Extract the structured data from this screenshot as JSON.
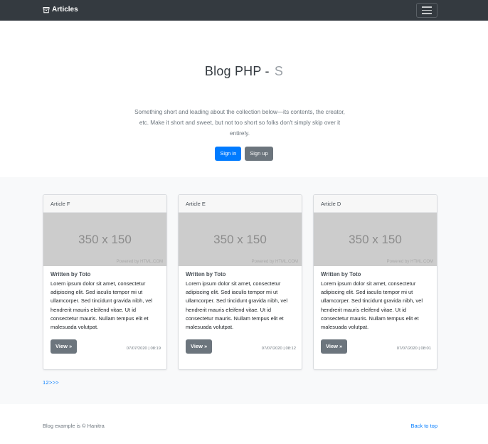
{
  "navbar": {
    "brand": "Articles",
    "brand_icon": "box-icon",
    "toggler_icon": "hamburger-menu-icon"
  },
  "hero": {
    "title": "Blog PHP",
    "title_separator": "-",
    "title_typed": "S",
    "lead": "Something short and leading about the collection below—its contents, the creator, etc. Make it short and sweet, but not too short so folks don't simply skip over it entirely.",
    "sign_in_label": "Sign in",
    "sign_up_label": "Sign up"
  },
  "cards": [
    {
      "header": "Article F",
      "image_text": "350 x 150",
      "image_caption": "Powered by HTML.COM",
      "author": "Written by Toto",
      "text": "Lorem ipsum dolor sit amet, consectetur adipiscing elit. Sed iaculis tempor mi ut ullamcorper. Sed tincidunt gravida nibh, vel hendrerit mauris eleifend vitae. Ut id consectetur mauris. Nullam tempus elit et malesuada volutpat.",
      "button": "View »",
      "date": "07/07/2020 | 08:19"
    },
    {
      "header": "Article E",
      "image_text": "350 x 150",
      "image_caption": "Powered by HTML.COM",
      "author": "Written by Toto",
      "text": "Lorem ipsum dolor sit amet, consectetur adipiscing elit. Sed iaculis tempor mi ut ullamcorper. Sed tincidunt gravida nibh, vel hendrerit mauris eleifend vitae. Ut id consectetur mauris. Nullam tempus elit et malesuada volutpat.",
      "button": "View »",
      "date": "07/07/2020 | 08:12"
    },
    {
      "header": "Article D",
      "image_text": "350 x 150",
      "image_caption": "Powered by HTML.COM",
      "author": "Written by Toto",
      "text": "Lorem ipsum dolor sit amet, consectetur adipiscing elit. Sed iaculis tempor mi ut ullamcorper. Sed tincidunt gravida nibh, vel hendrerit mauris eleifend vitae. Ut id consectetur mauris. Nullam tempus elit et malesuada volutpat.",
      "button": "View »",
      "date": "07/07/2020 | 08:01"
    }
  ],
  "pagination": "12>>>",
  "footer": {
    "copyright": "Blog example is © Hanitra",
    "back_to_top": "Back to top"
  },
  "colors": {
    "navbar_bg": "#343a40",
    "primary": "#007bff",
    "secondary": "#6c757d",
    "album_bg": "#f8f9fa",
    "placeholder_bg": "#cccccc"
  }
}
